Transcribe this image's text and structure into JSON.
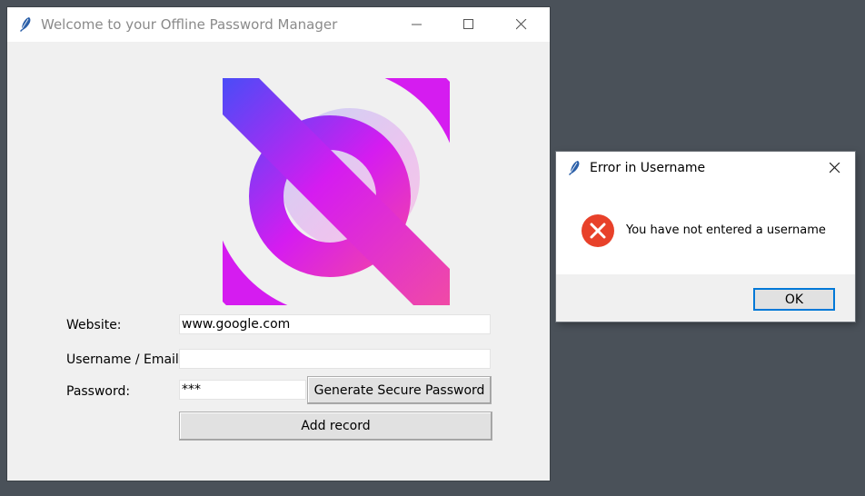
{
  "main_window": {
    "title": "Welcome to your Offline Password Manager",
    "form": {
      "website_label": "Website:",
      "website_value": "www.google.com",
      "username_label": "Username / Email:",
      "username_value": "",
      "password_label": "Password:",
      "password_value": "***",
      "generate_label": "Generate Secure Password",
      "add_label": "Add record"
    }
  },
  "dialog": {
    "title": "Error in Username",
    "message": "You have not entered a username",
    "ok_label": "OK",
    "icon": "error-icon"
  },
  "colors": {
    "desktop": "#4a5159",
    "window_bg": "#f0f0f0",
    "accent": "#0078d7",
    "error_red": "#e8412a",
    "logo_blue": "#4a4cf7",
    "logo_magenta": "#d51cf0",
    "logo_pink": "#f04aa6"
  }
}
